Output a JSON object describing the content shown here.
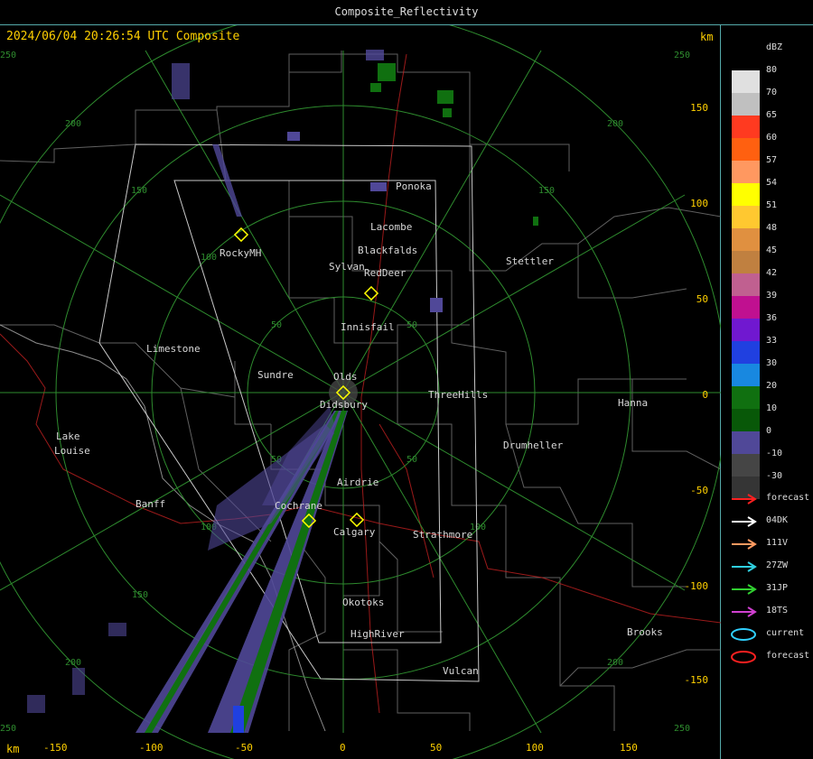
{
  "window": {
    "title": "Composite_Reflectivity"
  },
  "header": {
    "timestamp": "2024/06/04 20:26:54 UTC Composite",
    "unit_top": "km",
    "unit_bottom": "km"
  },
  "map": {
    "range_rings_km": [
      "50",
      "100",
      "150",
      "200",
      "250"
    ],
    "x_axis_ticks": [
      "-150",
      "-100",
      "-50",
      "0",
      "50",
      "100",
      "150"
    ],
    "y_axis_ticks": [
      "150",
      "100",
      "50",
      "0",
      "-50",
      "-100",
      "-150"
    ],
    "places": {
      "ponoka": "Ponoka",
      "lacombe": "Lacombe",
      "blackfalds": "Blackfalds",
      "sylvan": "Sylvan",
      "reddeer": "RedDeer",
      "stettler": "Stettler",
      "rockymh": "RockyMH",
      "innisfail": "Innisfail",
      "limestone": "Limestone",
      "sundre": "Sundre",
      "olds": "Olds",
      "didsbury": "Didsbury",
      "threehills": "ThreeHills",
      "hanna": "Hanna",
      "lake": "Lake",
      "louise": "Louise",
      "drumheller": "Drumheller",
      "airdrie": "Airdrie",
      "banff": "Banff",
      "cochrane": "Cochrane",
      "calgary": "Calgary",
      "strathmore": "Strathmore",
      "okotoks": "Okotoks",
      "highriver": "HighRiver",
      "brooks": "Brooks",
      "vulcan": "Vulcan"
    }
  },
  "legend": {
    "title": "dBZ",
    "scale": [
      {
        "label": "80",
        "color": "#e0e0e0"
      },
      {
        "label": "70",
        "color": "#c0c0c0"
      },
      {
        "label": "65",
        "color": "#ff3a20"
      },
      {
        "label": "60",
        "color": "#ff6010"
      },
      {
        "label": "57",
        "color": "#ff9860"
      },
      {
        "label": "54",
        "color": "#ffff00"
      },
      {
        "label": "51",
        "color": "#ffc830"
      },
      {
        "label": "48",
        "color": "#e09040"
      },
      {
        "label": "45",
        "color": "#c08040"
      },
      {
        "label": "42",
        "color": "#c06090"
      },
      {
        "label": "39",
        "color": "#c01090"
      },
      {
        "label": "36",
        "color": "#7018d0"
      },
      {
        "label": "33",
        "color": "#2040e0"
      },
      {
        "label": "30",
        "color": "#1888e0"
      },
      {
        "label": "20",
        "color": "#107010"
      },
      {
        "label": "10",
        "color": "#085808"
      },
      {
        "label": "0",
        "color": "#504898"
      },
      {
        "label": "-10",
        "color": "#454545"
      },
      {
        "label": "-30",
        "color": "#353535"
      }
    ],
    "overlays": [
      {
        "label": "forecast",
        "color": "#ff2020",
        "kind": "arrow"
      },
      {
        "label": "04DK",
        "color": "#ffffff",
        "kind": "arrow"
      },
      {
        "label": "111V",
        "color": "#ff9a60",
        "kind": "arrow"
      },
      {
        "label": "27ZW",
        "color": "#30d0e0",
        "kind": "arrow"
      },
      {
        "label": "31JP",
        "color": "#30d030",
        "kind": "arrow"
      },
      {
        "label": "18TS",
        "color": "#d040d0",
        "kind": "arrow"
      },
      {
        "label": "current",
        "color": "#30d0ff",
        "kind": "ellipse"
      },
      {
        "label": "forecast",
        "color": "#ff2020",
        "kind": "ellipse"
      }
    ]
  }
}
